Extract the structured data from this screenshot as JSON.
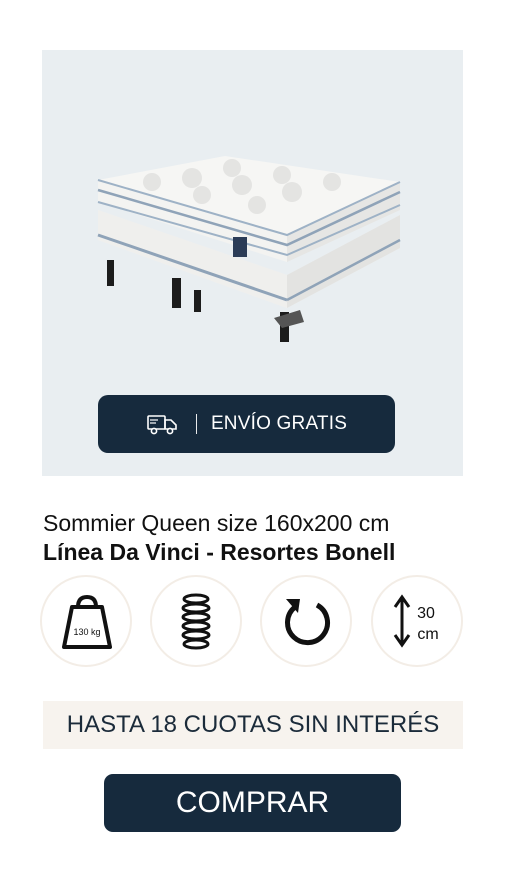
{
  "product": {
    "title_line1": "Sommier Queen size 160x200 cm",
    "title_line2": "Línea Da Vinci - Resortes Bonell"
  },
  "badge": {
    "label": "ENVÍO GRATIS",
    "icon": "truck-icon"
  },
  "features": {
    "weight_label": "130 kg",
    "height_value": "30",
    "height_unit": "cm",
    "icons": [
      "weight-icon",
      "spring-icon",
      "rotate-icon",
      "height-arrows-icon"
    ]
  },
  "promo": {
    "label": "HASTA 18 CUOTAS SIN INTERÉS"
  },
  "cta": {
    "label": "COMPRAR"
  },
  "colors": {
    "dark": "#162a3d",
    "image_bg": "#e9eef1",
    "promo_bg": "#f7f3ee",
    "circle_border": "#f3ede6"
  }
}
